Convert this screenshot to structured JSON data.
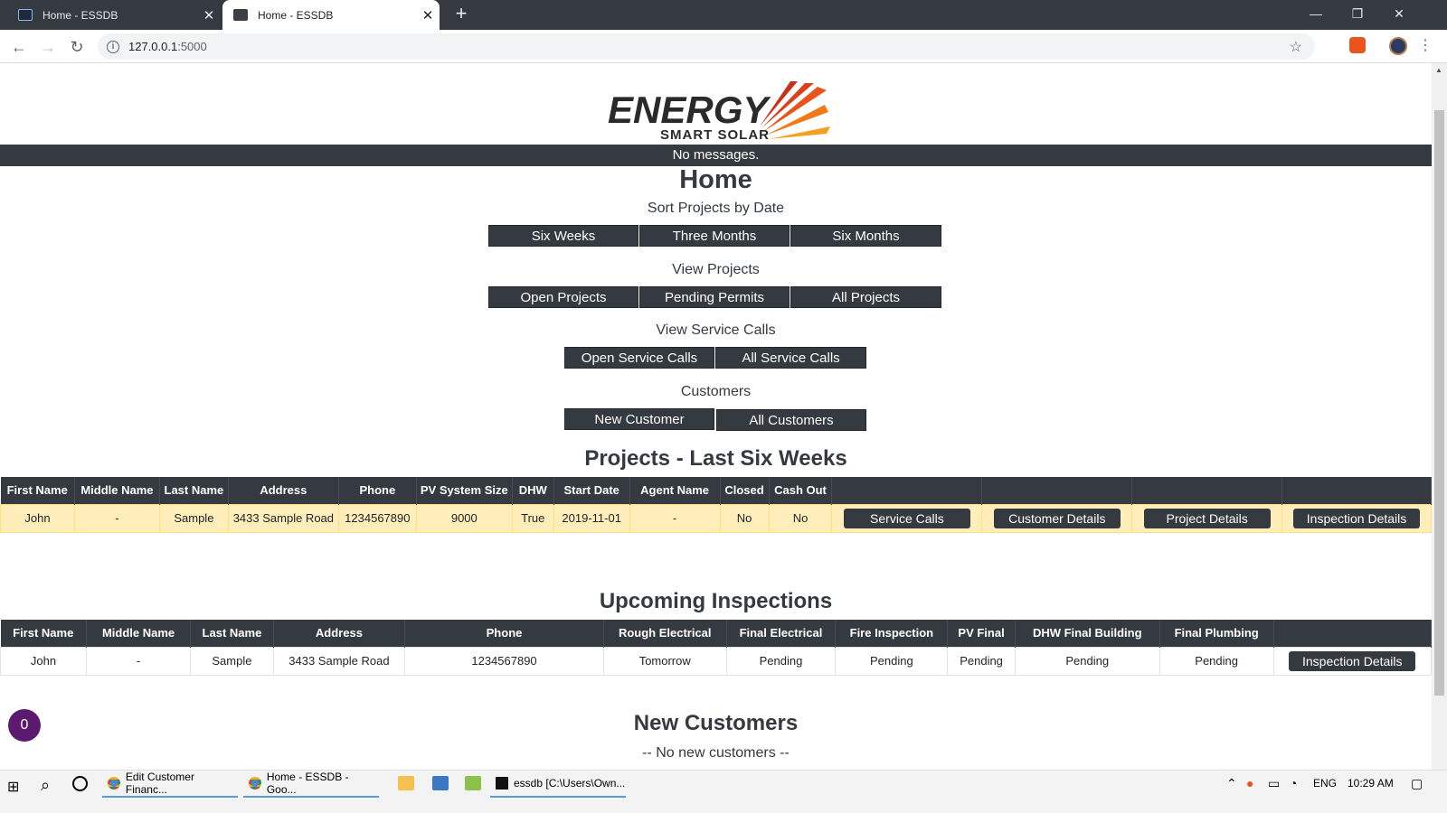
{
  "browser": {
    "tabs": [
      {
        "title": "Home - ESSDB",
        "active": false
      },
      {
        "title": "Home - ESSDB",
        "active": true
      }
    ],
    "url_host": "127.0.0.1",
    "url_port": ":5000"
  },
  "header": {
    "logo_word_top": "ENERGY",
    "logo_word_bottom": "SMART SOLAR",
    "messages": "No messages."
  },
  "main": {
    "title": "Home",
    "sort_section": {
      "label": "Sort Projects by Date",
      "buttons": [
        "Six Weeks",
        "Three Months",
        "Six Months"
      ]
    },
    "view_projects": {
      "label": "View Projects",
      "buttons": [
        "Open Projects",
        "Pending Permits",
        "All Projects"
      ]
    },
    "service_calls": {
      "label": "View Service Calls",
      "buttons": [
        "Open Service Calls",
        "All Service Calls"
      ]
    },
    "customers": {
      "label": "Customers",
      "buttons": [
        "New Customer",
        "All Customers"
      ]
    }
  },
  "projects": {
    "title": "Projects - Last Six Weeks",
    "columns": [
      "First Name",
      "Middle Name",
      "Last Name",
      "Address",
      "Phone",
      "PV System Size",
      "DHW",
      "Start Date",
      "Agent Name",
      "Closed",
      "Cash Out"
    ],
    "rows": [
      {
        "cells": [
          "John",
          "-",
          "Sample",
          "3433 Sample Road",
          "1234567890",
          "9000",
          "True",
          "2019-11-01",
          "-",
          "No",
          "No"
        ],
        "actions": [
          "Service Calls",
          "Customer Details",
          "Project Details",
          "Inspection Details"
        ]
      }
    ]
  },
  "inspections": {
    "title": "Upcoming Inspections",
    "columns": [
      "First Name",
      "Middle Name",
      "Last Name",
      "Address",
      "Phone",
      "Rough Electrical",
      "Final Electrical",
      "Fire Inspection",
      "PV Final",
      "DHW Final Building",
      "Final Plumbing"
    ],
    "rows": [
      {
        "cells": [
          "John",
          "-",
          "Sample",
          "3433 Sample Road",
          "1234567890",
          "Tomorrow",
          "Pending",
          "Pending",
          "Pending",
          "Pending",
          "Pending"
        ],
        "action": "Inspection Details"
      }
    ]
  },
  "new_customers": {
    "title": "New Customers",
    "empty": "-- No new customers --"
  },
  "badge_count": "0",
  "taskbar": {
    "apps": [
      "Edit Customer Financ...",
      "Home - ESSDB - Goo...",
      "essdb [C:\\Users\\Own..."
    ],
    "lang": "ENG",
    "time": "10:29 AM"
  },
  "colors": {
    "dark": "#343a40",
    "highlight_row": "#ffeeba",
    "badge": "#5b1a6e",
    "logo_orange": "#e8541c"
  }
}
